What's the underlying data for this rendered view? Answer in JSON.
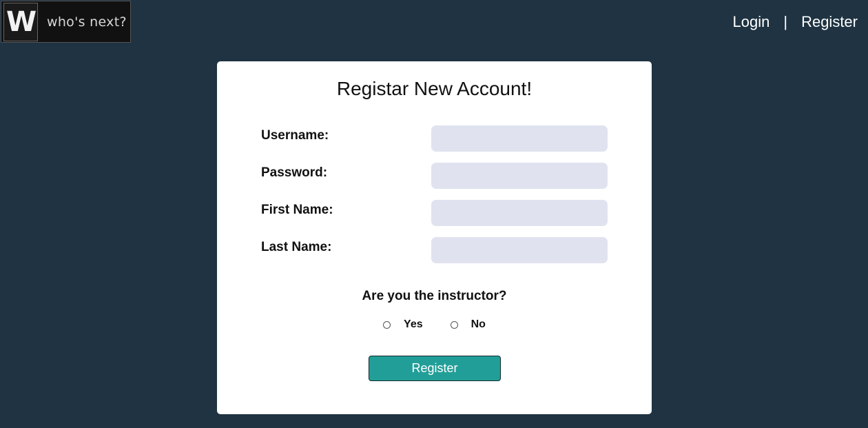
{
  "logo": {
    "mark": "W",
    "text": "who's next?"
  },
  "nav": {
    "login": "Login",
    "separator": "|",
    "register": "Register"
  },
  "form": {
    "title": "Registar New Account!",
    "fields": [
      {
        "label": "Username:",
        "value": "",
        "placeholder": ""
      },
      {
        "label": "Password:",
        "value": "",
        "placeholder": ""
      },
      {
        "label": "First Name:",
        "value": "",
        "placeholder": ""
      },
      {
        "label": "Last Name:",
        "value": "",
        "placeholder": ""
      }
    ],
    "question": "Are you the instructor?",
    "options": [
      {
        "label": "Yes",
        "selected": false
      },
      {
        "label": "No",
        "selected": false
      }
    ],
    "submit_label": "Register"
  },
  "colors": {
    "background": "#1f3342",
    "card": "#ffffff",
    "input": "#e0e3ef",
    "button": "#229e98"
  }
}
